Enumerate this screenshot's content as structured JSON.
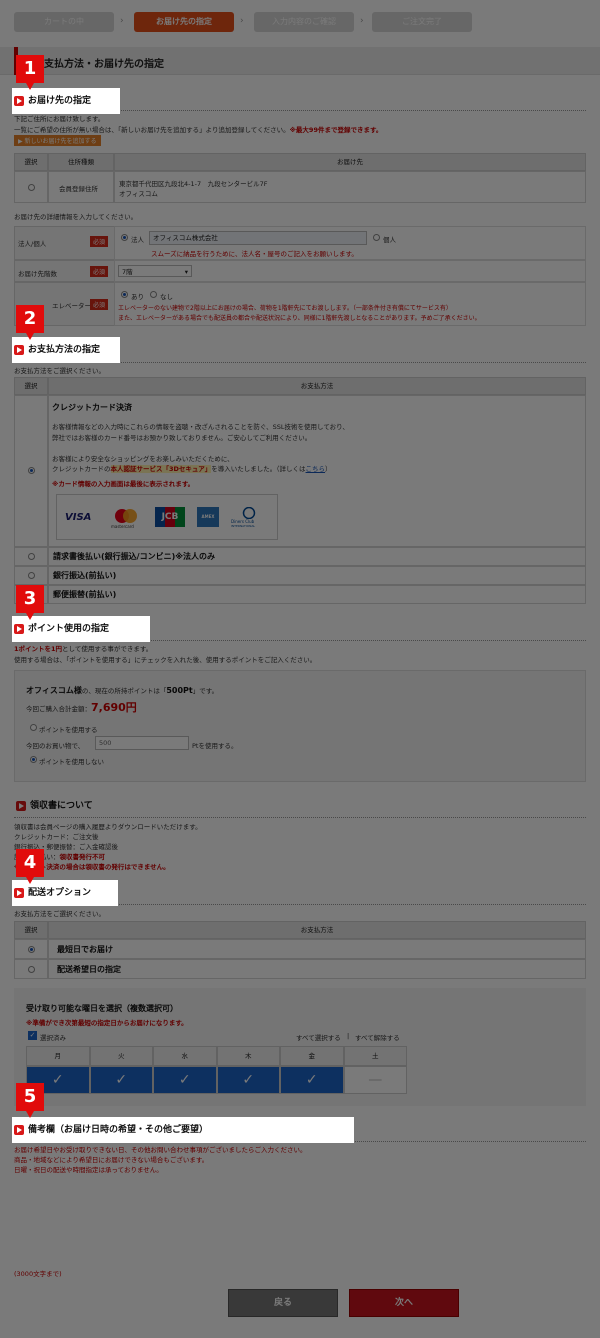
{
  "steps": [
    {
      "label": "カートの中"
    },
    {
      "label": "お届け先の指定"
    },
    {
      "label": "入力内容のご確認"
    },
    {
      "label": "ご注文完了"
    }
  ],
  "page_title": "お支払方法・お届け先の指定",
  "badges": [
    "1",
    "2",
    "3",
    "4",
    "5"
  ],
  "section1": {
    "title": "お届け先の指定",
    "desc1": "下記ご住所にお届け致します。",
    "desc2": "一覧にご希望の住所が無い場合は、「新しいお届け先を追加する」より追加登録してください。",
    "desc2_red": "※最大99件まで登録できます。",
    "add_button": "▶ 新しいお届け先を追加する",
    "col_select": "選択",
    "col_type": "住所種類",
    "col_dest": "お届け先",
    "row_type": "会員登録住所",
    "row_addr1": "東京都千代田区九段北4-1-7　九段センタービル7F",
    "row_addr2": "オフィスコム",
    "detail_note": "お届け先の詳細情報を入力してください。",
    "corp_label": "法人/個人",
    "required": "必須",
    "corp_opt": "法人",
    "corp_value": "オフィスコム株式会社",
    "corp_note": "スムーズに納品を行うために、法人名・屋号のご記入をお願いします。",
    "person_opt": "個人",
    "floor_label": "お届け先階数",
    "floor_value": "7階",
    "elevator_label": "エレベーター",
    "elev_yes": "あり",
    "elev_no": "なし",
    "elev_note1": "エレベーターのない建物で2階以上にお届けの場合、荷物を1階軒先にてお渡しします。（一部条件付き有償にてサービス有）",
    "elev_note2": "また、エレベーターがある場合でも配送員の都合や配送状況により、同様に1階軒先渡しとなることがあります。予めご了承ください。"
  },
  "section2": {
    "title": "お支払方法の指定",
    "desc": "お支払方法をご選択ください。",
    "col_select": "選択",
    "col_method": "お支払方法",
    "credit_title": "クレジットカード決済",
    "credit_p1a": "お客様情報などの入力時にこれらの情報を盗聴・改ざんされることを防ぐ、SSL技術を使用しており、",
    "credit_p1b": "弊社ではお客様のカード番号はお預かり致しておりません。ご安心してご利用ください。",
    "credit_p2a": "お客様により安全なショッピングをお楽しみいただくために、",
    "credit_p2b_pre": "クレジットカードの",
    "credit_p2b_hl": "本人認証サービス「3Dセキュア」",
    "credit_p2b_post": "を導入いたしました。（詳しくは",
    "credit_link": "こちら",
    "credit_p2b_end": "）",
    "credit_red": "※カード情報の入力画面は最後に表示されます。",
    "card_visa": "VISA",
    "card_mc": "mastercard",
    "card_jcb": "JCB",
    "card_amex": "AMEX",
    "card_diners": "Diners Club",
    "card_diners_sub": "INTERNATIONAL",
    "opt2": "請求書後払い(銀行振込/コンビニ)※法人のみ",
    "opt3": "銀行振込(前払い)",
    "opt4": "郵便振替(前払い)"
  },
  "section3": {
    "title": "ポイント使用の指定",
    "desc1_red": "1ポイントを1円",
    "desc1": "として使用する事ができます。",
    "desc2": "使用する場合は、「ポイントを使用する」にチェックを入れた後、使用するポイントをご記入ください。",
    "user": "オフィスコム様",
    "user_post": "の、現在の所持ポイントは「",
    "points": "500Pt",
    "user_end": "」です。",
    "total_label": "今回ご購入合計金額：",
    "total": "7,690円",
    "use_point": "ポイントを使用する",
    "purchase_label": "今回のお買い物で、",
    "point_input": "500",
    "point_suffix": "Ptを使用する。",
    "no_point": "ポイントを使用しない"
  },
  "receipt": {
    "title": "領収書について",
    "l1": "領収書は会員ページの購入履歴よりダウンロードいただけます。",
    "l2": "クレジットカード：ご注文後",
    "l3": "銀行振込・郵便振替：ご入金確認後",
    "l4_pre": "請求書後払い：",
    "l4_red": "領収書発行不可",
    "l5_red": "※ポイント決済の場合は領収書の発行はできません。"
  },
  "section4": {
    "title": "配送オプション",
    "desc": "お支払方法をご選択ください。",
    "col_select": "選択",
    "col_method": "お支払方法",
    "opt1": "最短日でお届け",
    "opt2": "配送希望日の指定",
    "days_title": "受け取り可能な曜日を選択（複数選択可）",
    "days_red": "※準備ができ次第最短の指定日からお届けになります。",
    "selected_label": "選択済み",
    "select_all": "すべて選択する",
    "separator": "|",
    "clear_all": "すべて解除する",
    "days": [
      "月",
      "火",
      "水",
      "木",
      "金",
      "土"
    ],
    "checks": [
      "✓",
      "✓",
      "✓",
      "✓",
      "✓",
      "—"
    ],
    "day_selected": [
      1,
      1,
      1,
      1,
      1,
      0
    ]
  },
  "section5": {
    "title": "備考欄（お届け日時の希望・その他ご要望）",
    "note1": "お届け希望日やお受け取りできない日、その他お問い合わせ事項がございましたらご入力ください。",
    "note2": "商品・地域などにより希望日にお届けできない場合もございます。",
    "note3": "日曜・祝日の配送や時間指定は承っておりません。",
    "limit": "(3000文字まで)"
  },
  "buttons": {
    "back": "戻る",
    "next": "次へ"
  },
  "colors": {
    "accent_red": "#e10b0b",
    "active_step": "#e5501b",
    "selected_day": "#1d64c8",
    "next_button": "#c8141e"
  }
}
